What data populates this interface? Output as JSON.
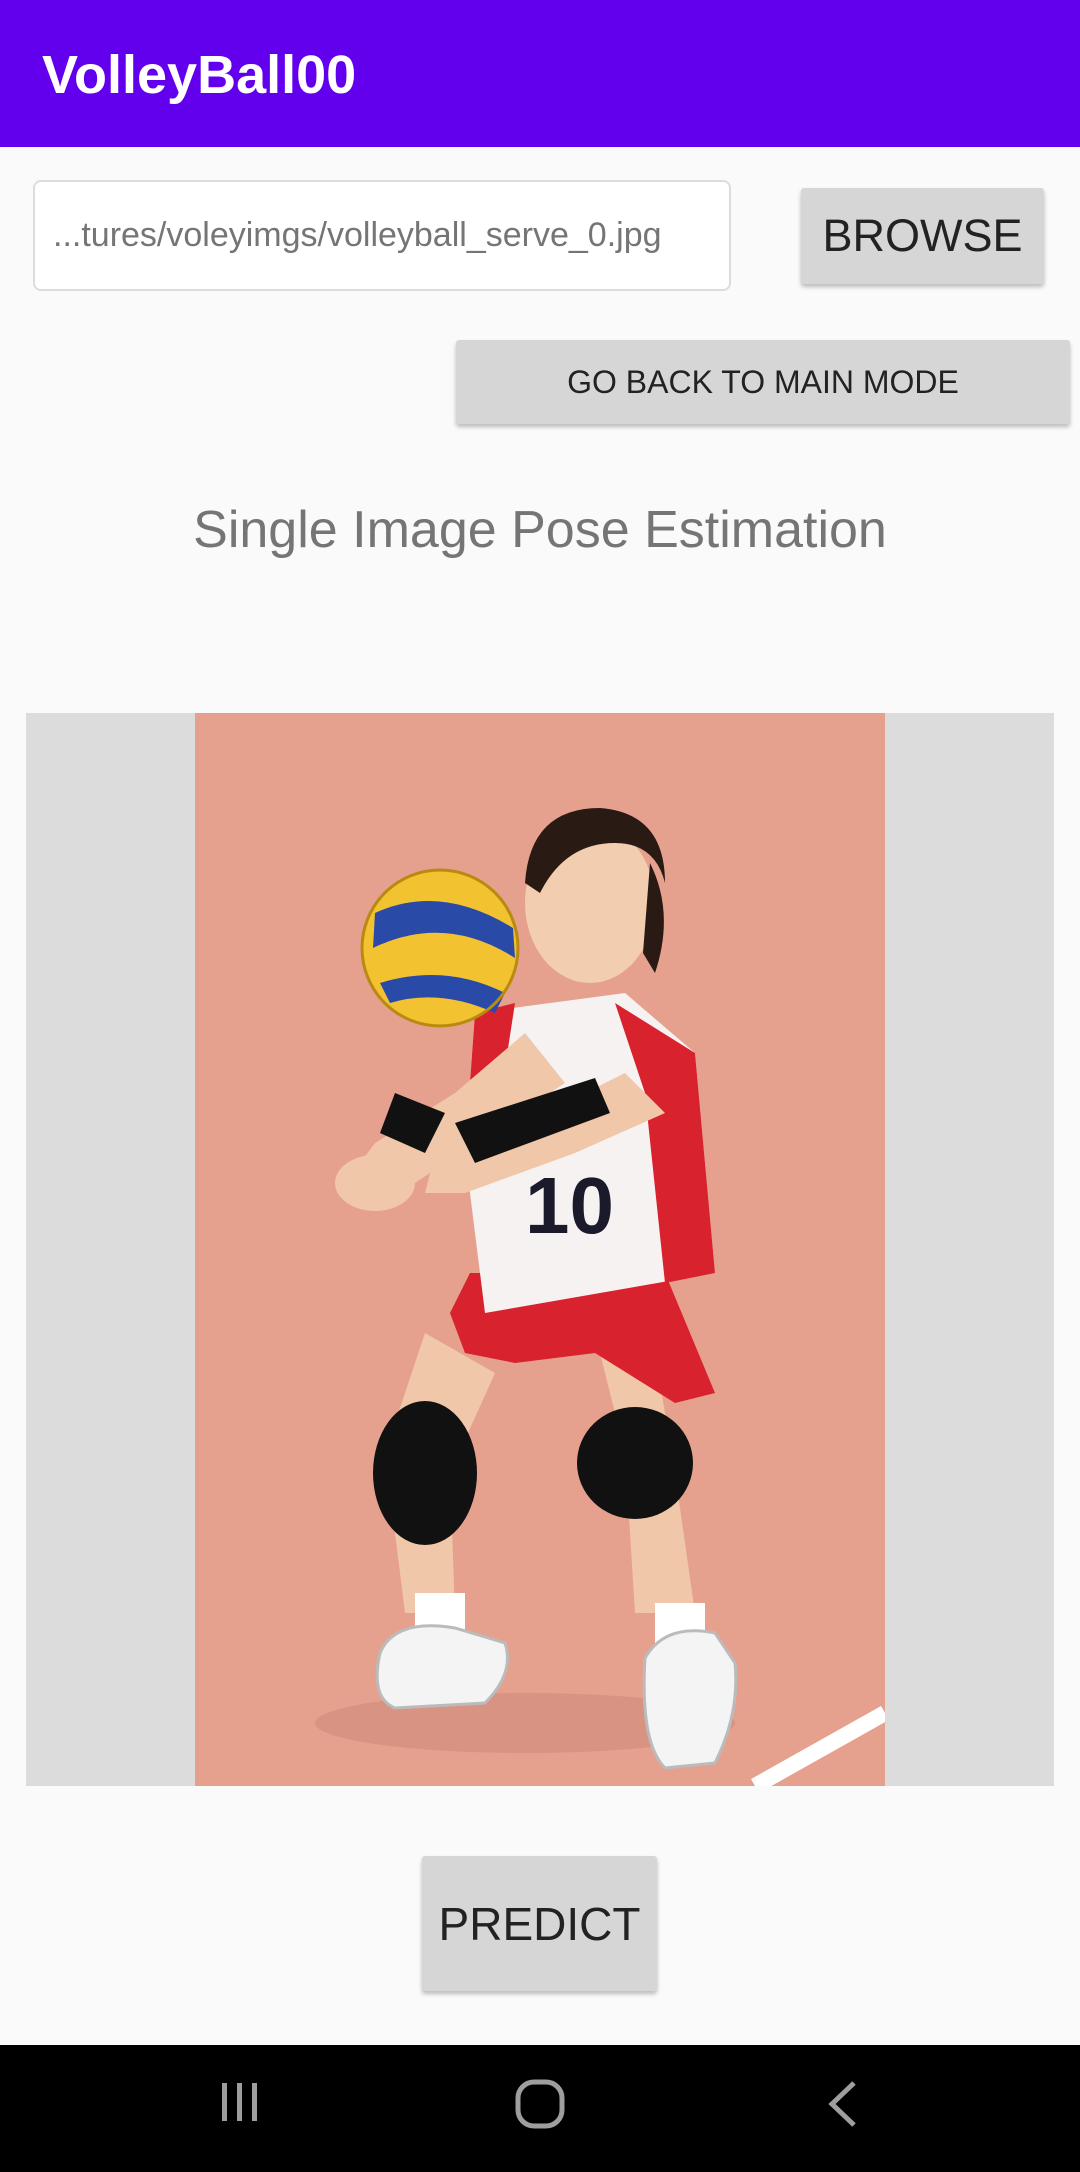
{
  "app_bar": {
    "title": "VolleyBall00",
    "color": "#6200ee"
  },
  "file_picker": {
    "path_value": "...tures/voleyimgs/volleyball_serve_0.jpg",
    "browse_label": "BROWSE"
  },
  "back_button": {
    "label": "GO BACK TO MAIN MODE"
  },
  "section": {
    "title": "Single Image Pose Estimation"
  },
  "image_preview": {
    "subject": "volleyball player in passing stance",
    "jersey_number": "10"
  },
  "predict_button": {
    "label": "PREDICT"
  },
  "nav_bar": {
    "icons": [
      "recent-apps-icon",
      "home-icon",
      "back-icon"
    ]
  }
}
